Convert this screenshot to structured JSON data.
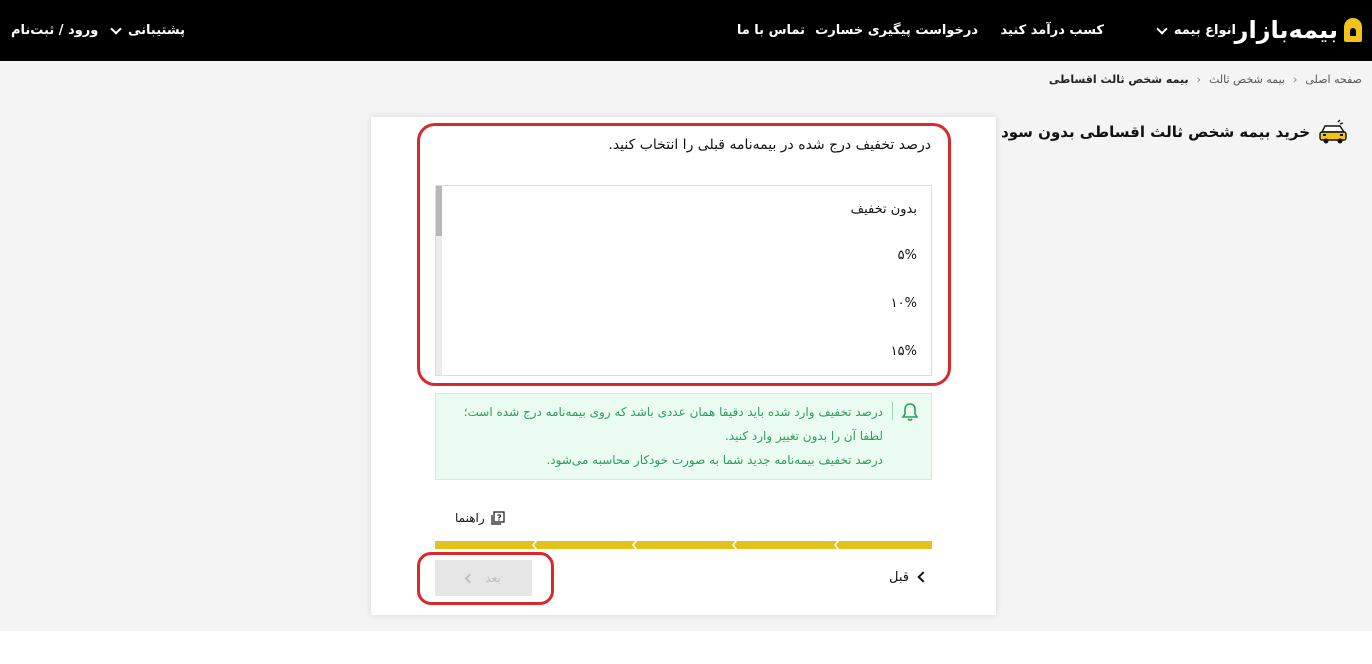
{
  "header": {
    "logo_text": "بیمه‌بازار",
    "nav": {
      "insurance_types": "انواع بیمه",
      "earn_income": "کسب درآمد کنید",
      "claim_tracking": "درخواست پیگیری خسارت",
      "contact_us": "تماس با ما",
      "support": "پشتیبانی",
      "login": "ورود / ثبت‌نام"
    }
  },
  "breadcrumb": {
    "home": "صفحه اصلی",
    "third_party": "بیمه شخص ثالث",
    "current": "بیمه شخص ثالث اقساطی"
  },
  "page_title": "خرید بیمه شخص ثالث اقساطی بدون سود",
  "form": {
    "question": "درصد تخفیف درج شده در بیمه‌نامه قبلی را انتخاب کنید.",
    "options": [
      "بدون تخفیف",
      "۵%",
      "۱۰%",
      "۱۵%"
    ],
    "notice_lines": [
      "درصد تخفیف وارد شده باید دقیقا همان عددی باشد که روی بیمه‌نامه درج شده است؛ لطفا آن را بدون تغییر وارد کنید.",
      "درصد تخفیف بیمه‌نامه جدید شما به صورت خودکار محاسبه می‌شود."
    ],
    "help_label": "راهنما",
    "prev_label": "قبل",
    "next_label": "بعد"
  },
  "colors": {
    "header_bg": "#000000",
    "brand_yellow": "#f2c31a",
    "progress_yellow": "#e4c21c",
    "notice_bg": "#eafbf1",
    "notice_text": "#2f9b60",
    "annotation_red": "#d62b2b"
  },
  "icons": {
    "logo": "logo-icon",
    "car": "car-icon",
    "bell": "bell-icon",
    "help": "help-icon"
  }
}
